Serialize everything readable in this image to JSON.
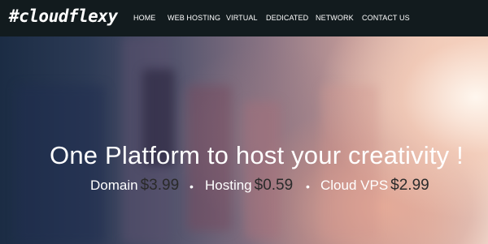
{
  "brand": {
    "logo_text": "#cloudflexy"
  },
  "nav": {
    "items": [
      {
        "label": "HOME"
      },
      {
        "label": "WEB HOSTING"
      },
      {
        "label": "VIRTUAL"
      },
      {
        "label": "DEDICATED"
      },
      {
        "label": "NETWORK"
      },
      {
        "label": "CONTACT US"
      }
    ]
  },
  "hero": {
    "headline": "One Platform to host your creativity !",
    "pricing": [
      {
        "label": "Domain",
        "price": "$3.99"
      },
      {
        "label": "Hosting",
        "price": "$0.59"
      },
      {
        "label": "Cloud VPS",
        "price": "$2.99"
      }
    ],
    "separator": "•"
  },
  "colors": {
    "navbar_bg": "#121b1e",
    "nav_text": "#ffffff",
    "hero_left": "#1b2c44",
    "hero_right": "#f6e2d6",
    "price_value": "#2a2a2a"
  }
}
